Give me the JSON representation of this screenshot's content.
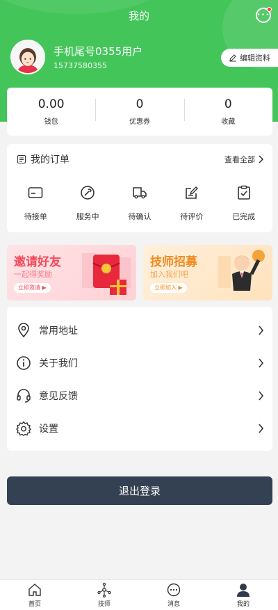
{
  "header": {
    "title": "我的"
  },
  "profile": {
    "name": "手机尾号0355用户",
    "phone": "15737580355",
    "edit_label": "编辑资料"
  },
  "stats": [
    {
      "value": "0.00",
      "label": "钱包"
    },
    {
      "value": "0",
      "label": "优惠券"
    },
    {
      "value": "0",
      "label": "收藏"
    }
  ],
  "orders": {
    "title": "我的订单",
    "see_all": "查看全部",
    "items": [
      {
        "label": "待接单",
        "icon": "card-icon"
      },
      {
        "label": "服务中",
        "icon": "wrench-icon"
      },
      {
        "label": "待确认",
        "icon": "truck-icon"
      },
      {
        "label": "待评价",
        "icon": "edit-icon"
      },
      {
        "label": "已完成",
        "icon": "clipboard-check-icon"
      }
    ]
  },
  "banners": {
    "invite": {
      "title": "邀请好友",
      "subtitle": "一起得奖励",
      "button": "立即邀请 ▶"
    },
    "recruit": {
      "title": "技师招募",
      "subtitle": "加入我们吧",
      "button": "立即加入 ▶"
    }
  },
  "menu": [
    {
      "label": "常用地址",
      "icon": "location-icon"
    },
    {
      "label": "关于我们",
      "icon": "info-icon"
    },
    {
      "label": "意见反馈",
      "icon": "feedback-icon"
    },
    {
      "label": "设置",
      "icon": "gear-icon"
    }
  ],
  "logout_label": "退出登录",
  "tabbar": [
    {
      "label": "首页",
      "icon": "home-icon"
    },
    {
      "label": "技师",
      "icon": "network-icon"
    },
    {
      "label": "消息",
      "icon": "chat-icon"
    },
    {
      "label": "我的",
      "icon": "user-icon",
      "active": true
    }
  ],
  "colors": {
    "brand_green": "#43c55a",
    "logout_bg": "#344152",
    "badge_red": "#ff3b30"
  }
}
